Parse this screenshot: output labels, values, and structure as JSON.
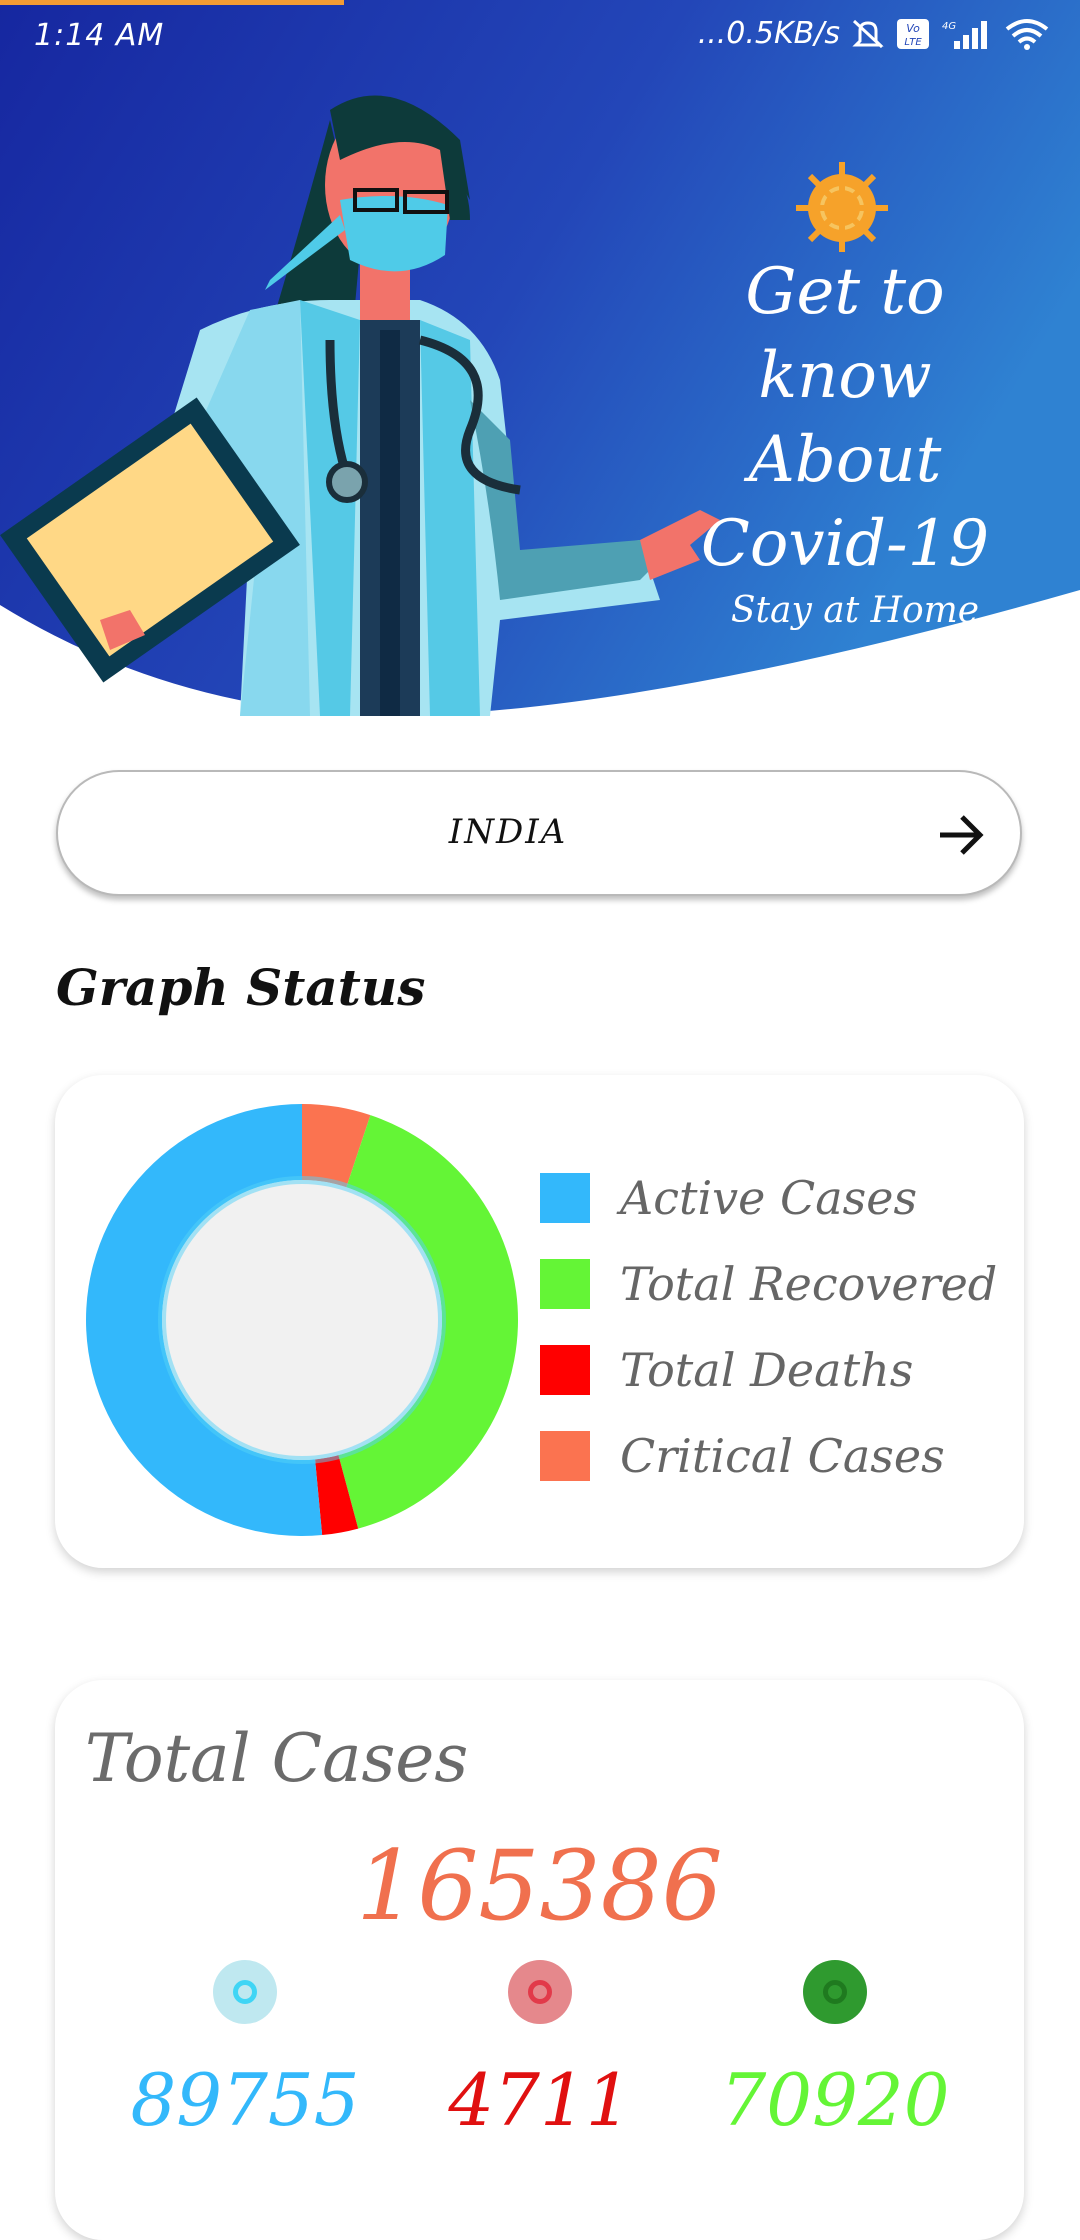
{
  "status_bar": {
    "time": "1:14 AM",
    "network_speed": "...0.5KB/s",
    "icons": [
      "mute-icon",
      "volte-icon",
      "signal-icon",
      "wifi-icon"
    ]
  },
  "hero": {
    "line1": "Get to",
    "line2": "know About",
    "line3": "Covid-19",
    "subtitle": "Stay at Home"
  },
  "country_selector": {
    "label": "INDIA",
    "icon": "arrow-right-icon"
  },
  "graph_section": {
    "title": "Graph Status",
    "legend": [
      {
        "label": "Active Cases",
        "color": "#33b8fb"
      },
      {
        "label": "Total Recovered",
        "color": "#64f536"
      },
      {
        "label": "Total Deaths",
        "color": "#ff0000"
      },
      {
        "label": "Critical Cases",
        "color": "#fb7350"
      }
    ]
  },
  "chart_data": {
    "type": "pie",
    "categories": [
      "Active Cases",
      "Total Recovered",
      "Total Deaths",
      "Critical Cases"
    ],
    "values": [
      89755,
      70920,
      4711,
      8944
    ],
    "colors": [
      "#33b8fb",
      "#64f536",
      "#ff0000",
      "#fb7350"
    ],
    "title": "",
    "legend": "right"
  },
  "totals": {
    "title": "Total Cases",
    "total": "165386",
    "stats": [
      {
        "value": "89755",
        "color": "#33b8fb",
        "dot": "#bfe8f0",
        "ring": "#3fd5f5"
      },
      {
        "value": "4711",
        "color": "#e01010",
        "dot": "#e5888c",
        "ring": "#e23a4a"
      },
      {
        "value": "70920",
        "color": "#64f536",
        "dot": "#2f9a2f",
        "ring": "#1f7a1f"
      }
    ]
  }
}
